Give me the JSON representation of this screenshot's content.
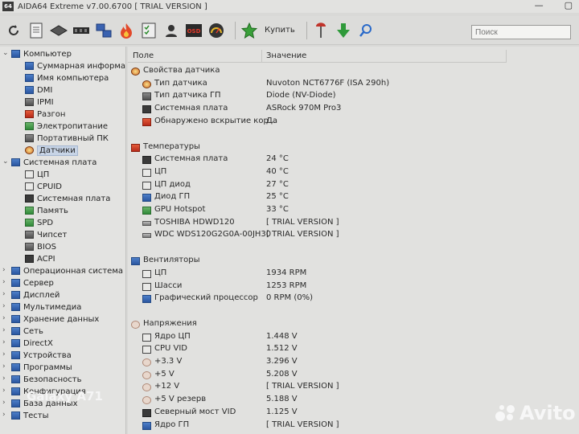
{
  "window": {
    "title": "AIDA64 Extreme v7.00.6700  [ TRIAL VERSION ]",
    "app_icon": "64"
  },
  "window_controls": {
    "minimize": "—",
    "maximize": "▢",
    "close": "✕"
  },
  "toolbar": {
    "buttons": [
      "refresh-icon",
      "report-icon",
      "chip-icon",
      "memory-icon",
      "network-icon",
      "flame-icon",
      "checklist-icon",
      "user-icon",
      "osd-icon",
      "gauge-icon",
      "star-icon",
      "tool-icon",
      "download-icon",
      "search-icon"
    ],
    "buy_label": "Купить"
  },
  "search": {
    "placeholder": "Поиск"
  },
  "tree": [
    {
      "label": "Компьютер",
      "level": 0,
      "arrow": "v"
    },
    {
      "label": "Суммарная информаци",
      "level": 1
    },
    {
      "label": "Имя компьютера",
      "level": 1
    },
    {
      "label": "DMI",
      "level": 1
    },
    {
      "label": "IPMI",
      "level": 1
    },
    {
      "label": "Разгон",
      "level": 1
    },
    {
      "label": "Электропитание",
      "level": 1
    },
    {
      "label": "Портативный ПК",
      "level": 1
    },
    {
      "label": "Датчики",
      "level": 1,
      "selected": true
    },
    {
      "label": "Системная плата",
      "level": 0,
      "arrow": "v"
    },
    {
      "label": "ЦП",
      "level": 1
    },
    {
      "label": "CPUID",
      "level": 1
    },
    {
      "label": "Системная плата",
      "level": 1
    },
    {
      "label": "Память",
      "level": 1
    },
    {
      "label": "SPD",
      "level": 1
    },
    {
      "label": "Чипсет",
      "level": 1
    },
    {
      "label": "BIOS",
      "level": 1
    },
    {
      "label": "ACPI",
      "level": 1
    },
    {
      "label": "Операционная система",
      "level": 0,
      "arrow": ">"
    },
    {
      "label": "Сервер",
      "level": 0,
      "arrow": ">"
    },
    {
      "label": "Дисплей",
      "level": 0,
      "arrow": ">"
    },
    {
      "label": "Мультимедиа",
      "level": 0,
      "arrow": ">"
    },
    {
      "label": "Хранение данных",
      "level": 0,
      "arrow": ">"
    },
    {
      "label": "Сеть",
      "level": 0,
      "arrow": ">"
    },
    {
      "label": "DirectX",
      "level": 0,
      "arrow": ">"
    },
    {
      "label": "Устройства",
      "level": 0,
      "arrow": ">"
    },
    {
      "label": "Программы",
      "level": 0,
      "arrow": ">"
    },
    {
      "label": "Безопасность",
      "level": 0,
      "arrow": ">"
    },
    {
      "label": "Конфигурация",
      "level": 0,
      "arrow": ">"
    },
    {
      "label": "База данных",
      "level": 0,
      "arrow": ">"
    },
    {
      "label": "Тесты",
      "level": 0,
      "arrow": ">"
    }
  ],
  "table": {
    "col_field": "Поле",
    "col_value": "Значение",
    "rows": [
      {
        "type": "section",
        "name": "Свойства датчика",
        "icon": "gauge"
      },
      {
        "type": "item",
        "name": "Тип датчика",
        "value": "Nuvoton NCT6776F  (ISA 290h)",
        "icon": "gauge"
      },
      {
        "type": "item",
        "name": "Тип датчика ГП",
        "value": "Diode  (NV-Diode)",
        "icon": "grey"
      },
      {
        "type": "item",
        "name": "Системная плата",
        "value": "ASRock 970M Pro3",
        "icon": "dark"
      },
      {
        "type": "item",
        "name": "Обнаружено вскрытие кор...",
        "value": "Да",
        "icon": "red"
      },
      {
        "type": "spacer"
      },
      {
        "type": "section",
        "name": "Температуры",
        "icon": "red"
      },
      {
        "type": "item",
        "name": "Системная плата",
        "value": "24 °C",
        "icon": "dark"
      },
      {
        "type": "item",
        "name": "ЦП",
        "value": "40 °C",
        "icon": "outline"
      },
      {
        "type": "item",
        "name": "ЦП диод",
        "value": "27 °C",
        "icon": "outline"
      },
      {
        "type": "item",
        "name": "Диод ГП",
        "value": "25 °C",
        "icon": "blue"
      },
      {
        "type": "item",
        "name": "GPU Hotspot",
        "value": "33 °C",
        "icon": "green"
      },
      {
        "type": "item",
        "name": "TOSHIBA HDWD120",
        "value": "[ TRIAL VERSION ]",
        "icon": "drive"
      },
      {
        "type": "item",
        "name": "WDC WDS120G2G0A-00JH30",
        "value": "[ TRIAL VERSION ]",
        "icon": "drive"
      },
      {
        "type": "spacer"
      },
      {
        "type": "section",
        "name": "Вентиляторы",
        "icon": "blue"
      },
      {
        "type": "item",
        "name": "ЦП",
        "value": "1934 RPM",
        "icon": "outline"
      },
      {
        "type": "item",
        "name": "Шасси",
        "value": "1253 RPM",
        "icon": "outline"
      },
      {
        "type": "item",
        "name": "Графический процессор",
        "value": "0 RPM  (0%)",
        "icon": "blue"
      },
      {
        "type": "spacer"
      },
      {
        "type": "section",
        "name": "Напряжения",
        "icon": "volt"
      },
      {
        "type": "item",
        "name": "Ядро ЦП",
        "value": "1.448 V",
        "icon": "outline"
      },
      {
        "type": "item",
        "name": "CPU VID",
        "value": "1.512 V",
        "icon": "outline"
      },
      {
        "type": "item",
        "name": "+3.3 V",
        "value": "3.296 V",
        "icon": "volt"
      },
      {
        "type": "item",
        "name": "+5 V",
        "value": "5.208 V",
        "icon": "volt"
      },
      {
        "type": "item",
        "name": "+12 V",
        "value": "[ TRIAL VERSION ]",
        "icon": "volt"
      },
      {
        "type": "item",
        "name": "+5 V резерв",
        "value": "5.188 V",
        "icon": "volt"
      },
      {
        "type": "item",
        "name": "Северный мост VID",
        "value": "1.125 V",
        "icon": "dark"
      },
      {
        "type": "item",
        "name": "Ядро ГП",
        "value": "[ TRIAL VERSION ]",
        "icon": "blue"
      }
    ]
  },
  "overlay": {
    "device": "Galaxy A71",
    "marketplace": "Avito"
  }
}
